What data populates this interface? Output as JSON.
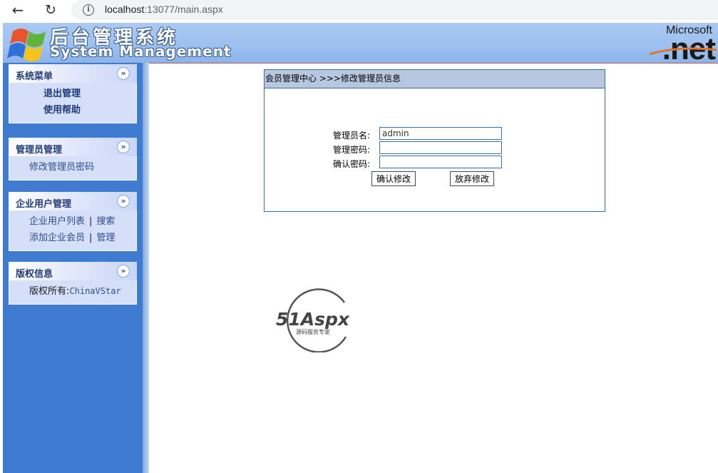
{
  "browser": {
    "url_host": "localhost",
    "url_rest": ":13077/main.aspx"
  },
  "header": {
    "title_cn": "后台管理系统",
    "title_en": "System Management",
    "brand_small": "Microsoft",
    "brand_large": ".net"
  },
  "sidebar": {
    "system_menu": {
      "title": "系统菜单",
      "items": [
        "退出管理",
        "使用帮助"
      ]
    },
    "admin_manage": {
      "title": "管理员管理",
      "items": [
        "修改管理员密码"
      ]
    },
    "enterprise_manage": {
      "title": "企业用户管理",
      "row1": [
        "企业用户列表",
        "搜索"
      ],
      "row2": [
        "添加企业会员",
        "管理"
      ],
      "separator": "|"
    },
    "copyright": {
      "title": "版权信息",
      "label": "版权所有:",
      "value": "ChinaVStar"
    }
  },
  "form": {
    "breadcrumb": "会员管理中心 >>>修改管理员信息",
    "username_label": "管理员名:",
    "username_value": "admin",
    "password_label": "管理密码:",
    "confirm_label": "确认密码:",
    "submit_label": "确认修改",
    "cancel_label": "放弃修改"
  },
  "logo": {
    "brand_main": "51Aspx",
    "brand_sub": "源码服务专家"
  }
}
